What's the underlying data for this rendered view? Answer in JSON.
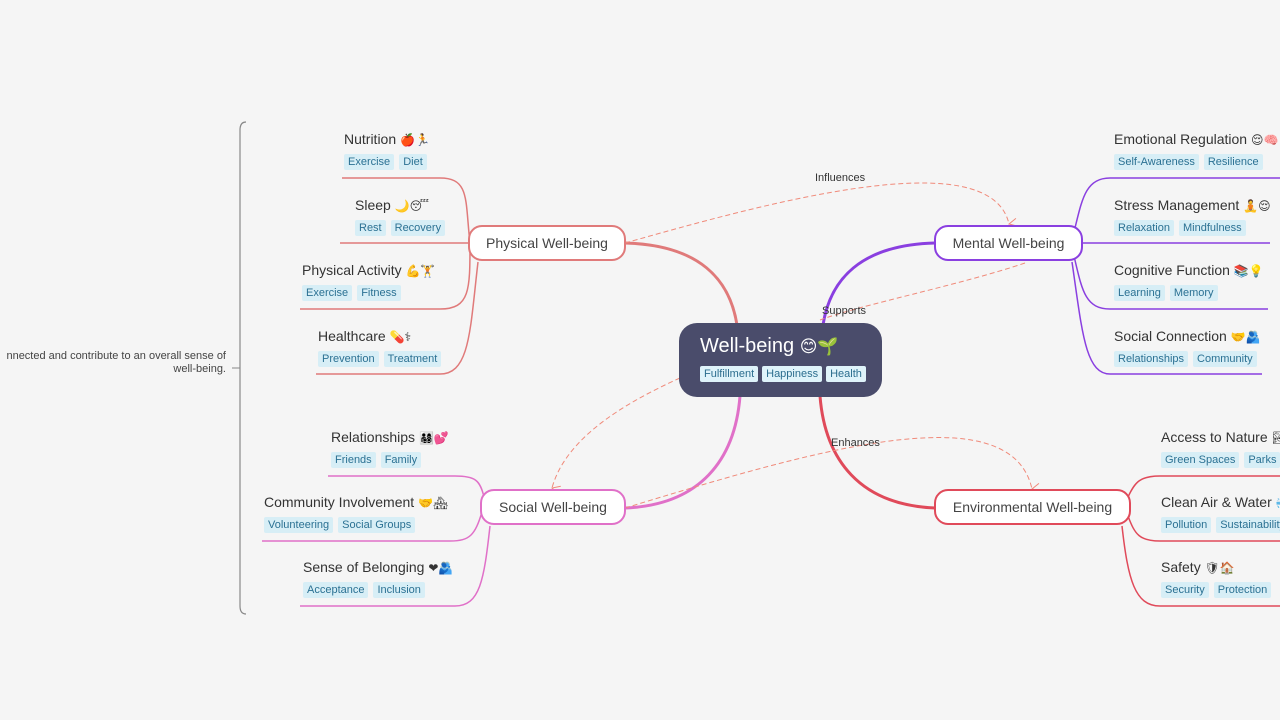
{
  "central": {
    "title": "Well-being",
    "emoji": "😊🌱",
    "tags": [
      "Fulfillment",
      "Happiness",
      "Health"
    ]
  },
  "summary_note": {
    "line1": "nnected and contribute to an overall sense of",
    "line2": "well-being."
  },
  "colors": {
    "central_bg": "#4a4c6b",
    "physical": "#e07a7a",
    "mental": "#8a3fe0",
    "social": "#e070c8",
    "environmental": "#e04a5a",
    "relationship": "#f08a7a",
    "tag_bg": "#d7eef6",
    "tag_text": "#2b7193"
  },
  "branches": {
    "physical": {
      "label": "Physical Well-being",
      "children": [
        {
          "label": "Nutrition",
          "emoji": "🍎🏃",
          "tags": [
            "Exercise",
            "Diet"
          ]
        },
        {
          "label": "Sleep",
          "emoji": "🌙😴",
          "tags": [
            "Rest",
            "Recovery"
          ]
        },
        {
          "label": "Physical Activity",
          "emoji": "💪🏋",
          "tags": [
            "Exercise",
            "Fitness"
          ]
        },
        {
          "label": "Healthcare",
          "emoji": "💊⚕",
          "tags": [
            "Prevention",
            "Treatment"
          ]
        }
      ]
    },
    "mental": {
      "label": "Mental Well-being",
      "children": [
        {
          "label": "Emotional Regulation",
          "emoji": "😌🧠",
          "tags": [
            "Self-Awareness",
            "Resilience"
          ]
        },
        {
          "label": "Stress Management",
          "emoji": "🧘😌",
          "tags": [
            "Relaxation",
            "Mindfulness"
          ]
        },
        {
          "label": "Cognitive Function",
          "emoji": "📚💡",
          "tags": [
            "Learning",
            "Memory"
          ]
        },
        {
          "label": "Social Connection",
          "emoji": "🤝🫂",
          "tags": [
            "Relationships",
            "Community"
          ]
        }
      ]
    },
    "social": {
      "label": "Social Well-being",
      "children": [
        {
          "label": "Relationships",
          "emoji": "👨‍👩‍👧‍👦💕",
          "tags": [
            "Friends",
            "Family"
          ]
        },
        {
          "label": "Community Involvement",
          "emoji": "🤝🏘",
          "tags": [
            "Volunteering",
            "Social Groups"
          ]
        },
        {
          "label": "Sense of Belonging",
          "emoji": "❤🫂",
          "tags": [
            "Acceptance",
            "Inclusion"
          ]
        }
      ]
    },
    "environmental": {
      "label": "Environmental Well-being",
      "children": [
        {
          "label": "Access to Nature",
          "emoji": "🏞",
          "tags": [
            "Green Spaces",
            "Parks"
          ]
        },
        {
          "label": "Clean Air & Water",
          "emoji": "💨",
          "tags": [
            "Pollution",
            "Sustainability"
          ]
        },
        {
          "label": "Safety",
          "emoji": "🛡🏠",
          "tags": [
            "Security",
            "Protection"
          ]
        }
      ]
    }
  },
  "relationships": [
    {
      "label": "Influences",
      "from": "Physical Well-being",
      "to": "Mental Well-being"
    },
    {
      "label": "Supports",
      "from": "Mental Well-being",
      "to": "Social Well-being"
    },
    {
      "label": "Enhances",
      "from": "Social Well-being",
      "to": "Environmental Well-being"
    }
  ]
}
